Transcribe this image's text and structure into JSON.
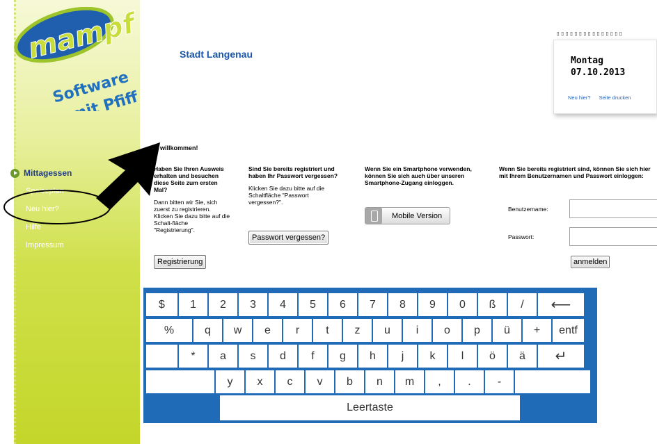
{
  "sidebar": {
    "logo_main": "mampf",
    "logo_sub1": "Software",
    "logo_sub2": "mit Pfiff",
    "section": "Mittagessen",
    "items": [
      {
        "label": "Speiseplan"
      },
      {
        "label": "Neu hier?"
      },
      {
        "label": "Hilfe"
      },
      {
        "label": "Impressum"
      }
    ]
  },
  "header": {
    "city": "Stadt Langenau"
  },
  "calendar": {
    "day": "Montag",
    "date": "07.10.2013",
    "link_new": "Neu hier?",
    "link_print": "Seite drucken"
  },
  "content": {
    "welcome": "h willkommen!",
    "col1": {
      "question": "Haben Sie Ihren Ausweis erhalten und besuchen diese Seite zum ersten Mal?",
      "text": "Dann bitten wir Sie, sich zuerst zu registrieren. Klicken Sie dazu bitte auf die Schalt-fläche \"Registrierung\".",
      "button": "Registrierung"
    },
    "col2": {
      "question": "Sind Sie bereits registriert und haben Ihr Passwort vergessen?",
      "text": "Klicken Sie dazu bitte auf die Schaltfläche \"Passwort vergessen?\".",
      "button": "Passwort vergessen?"
    },
    "col3": {
      "question": "Wenn Sie ein Smartphone verwenden, können Sie sich auch über unseren Smartphone-Zugang einloggen.",
      "button": "Mobile Version"
    },
    "col4": {
      "question": "Wenn Sie bereits registriert sind, können Sie sich hier mit Ihrem Benutzernamen und Passwort einloggen:",
      "username_label": "Benutzername:",
      "password_label": "Passwort:",
      "username_value": "",
      "password_value": "",
      "button": "anmelden"
    }
  },
  "keyboard": {
    "row1": [
      "$",
      "1",
      "2",
      "3",
      "4",
      "5",
      "6",
      "7",
      "8",
      "9",
      "0",
      "ß",
      "/",
      "⟵"
    ],
    "row2": [
      "%",
      "q",
      "w",
      "e",
      "r",
      "t",
      "z",
      "u",
      "i",
      "o",
      "p",
      "ü",
      "+",
      "entf"
    ],
    "row3": [
      "",
      "*",
      "a",
      "s",
      "d",
      "f",
      "g",
      "h",
      "j",
      "k",
      "l",
      "ö",
      "ä",
      "↵"
    ],
    "row4": [
      "",
      "y",
      "x",
      "c",
      "v",
      "b",
      "n",
      "m",
      ",",
      ".",
      "-",
      ""
    ],
    "space": "Leertaste"
  },
  "colors": {
    "accent_blue": "#1a56a8",
    "keyboard_blue": "#1f6bb8",
    "sidebar_green": "#c4d62a"
  }
}
